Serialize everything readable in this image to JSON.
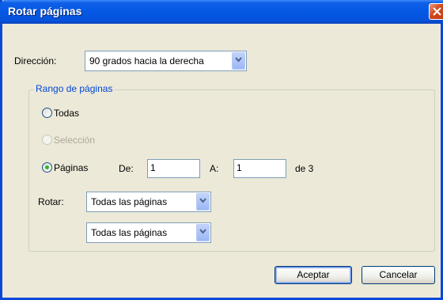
{
  "window": {
    "title": "Rotar páginas"
  },
  "direction": {
    "label": "Dirección:",
    "value": "90 grados hacia la derecha"
  },
  "page_range": {
    "title": "Rango de páginas",
    "options": {
      "all": "Todas",
      "selection": "Selección",
      "pages": "Páginas"
    },
    "selected": "pages",
    "from_label": "De:",
    "from_value": "1",
    "to_label": "A:",
    "to_value": "1",
    "of_text": "de 3",
    "rotate_label": "Rotar:",
    "rotate_value_1": "Todas las páginas",
    "rotate_value_2": "Todas las páginas"
  },
  "buttons": {
    "ok": "Aceptar",
    "cancel": "Cancelar"
  },
  "colors": {
    "titlebar": "#0558e4",
    "dialog_bg": "#ece9d8",
    "group_title": "#0046d5",
    "radio_dot": "#2ab72a"
  }
}
